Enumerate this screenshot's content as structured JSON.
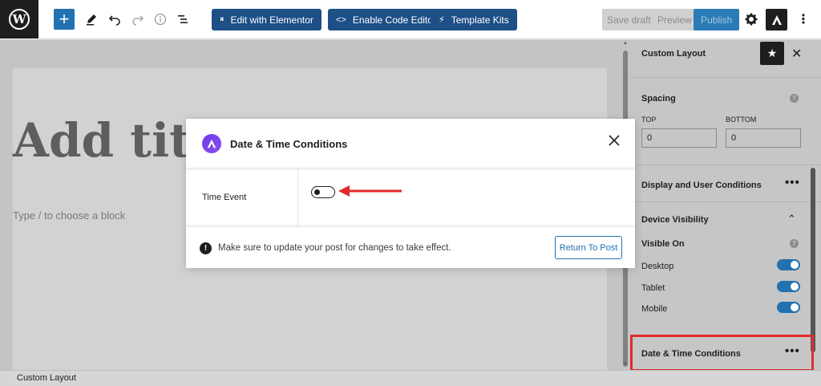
{
  "toolbar": {
    "edit_elementor": "Edit with Elementor",
    "enable_code_editor": "Enable Code Editor",
    "template_kits": "Template Kits",
    "save_draft": "Save draft",
    "preview": "Preview",
    "publish": "Publish"
  },
  "editor": {
    "title_placeholder": "Add title",
    "block_hint": "Type / to choose a block"
  },
  "sidebar": {
    "title": "Custom Layout",
    "spacing": {
      "label": "Spacing",
      "top_label": "TOP",
      "bottom_label": "BOTTOM",
      "top_value": "0",
      "bottom_value": "0"
    },
    "display_conditions": "Display and User Conditions",
    "device_visibility": "Device Visibility",
    "visible_on": "Visible On",
    "devices": [
      {
        "label": "Desktop",
        "enabled": true
      },
      {
        "label": "Tablet",
        "enabled": true
      },
      {
        "label": "Mobile",
        "enabled": true
      }
    ],
    "date_time_conditions": "Date & Time Conditions"
  },
  "modal": {
    "title": "Date & Time Conditions",
    "field_label": "Time Event",
    "time_event_enabled": false,
    "notice": "Make sure to update your post for changes to take effect.",
    "return_button": "Return To Post"
  },
  "footer": {
    "breadcrumb": "Custom Layout"
  },
  "colors": {
    "accent": "#2271b1",
    "highlight": "#e02b2b",
    "astra_purple": "#6a3de8"
  }
}
